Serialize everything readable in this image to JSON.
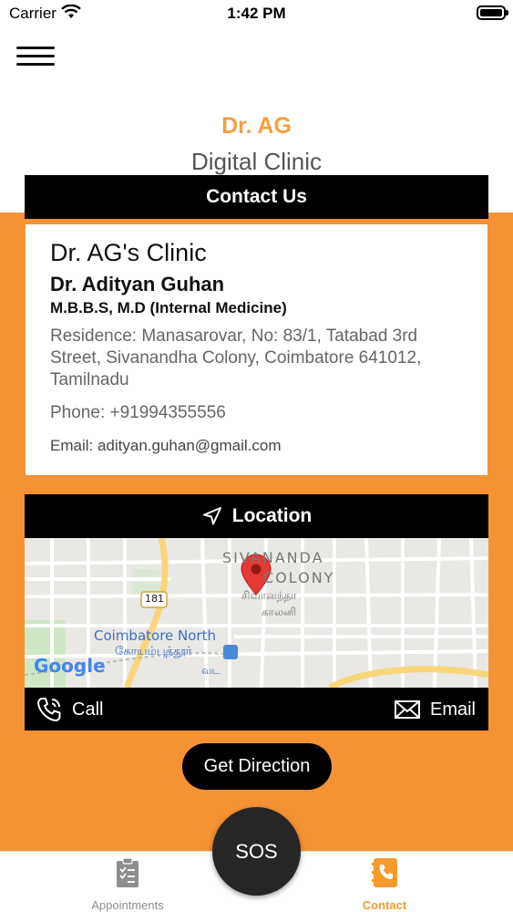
{
  "status_bar": {
    "carrier": "Carrier",
    "time": "1:42 PM"
  },
  "brand": {
    "name": "Dr. AG",
    "subtitle": "Digital Clinic"
  },
  "contact": {
    "header": "Contact Us",
    "clinic_name": "Dr. AG's Clinic",
    "doctor_name": "Dr. Adityan Guhan",
    "qualification": "M.B.B.S, M.D (Internal Medicine)",
    "address": "Residence: Manasarovar, No: 83/1, Tatabad 3rd Street, Sivanandha Colony, Coimbatore 641012, Tamilnadu",
    "phone": "Phone: +91994355556",
    "email": "Email: adityan.guhan@gmail.com"
  },
  "location": {
    "header": "Location",
    "map_labels": {
      "area_line1": "SIVANANDA",
      "area_line2": "COLONY",
      "area_tamil1": "சிவானந்தா",
      "area_tamil2": "காலனி",
      "road_number": "181",
      "station": "Coimbatore North",
      "station_tamil1": "கோயம்புத்தூர்",
      "station_tamil2": "வட",
      "google": "Google"
    }
  },
  "actions": {
    "call": "Call",
    "email": "Email",
    "get_direction": "Get Direction"
  },
  "tabs": [
    {
      "label": "Appointments",
      "icon": "clipboard-icon",
      "active": false
    },
    {
      "label": "Contact",
      "icon": "phone-book-icon",
      "active": true
    }
  ],
  "sos": {
    "label": "SOS"
  },
  "colors": {
    "accent": "#f59233",
    "brand": "#f5a03c",
    "bar": "#000000"
  }
}
